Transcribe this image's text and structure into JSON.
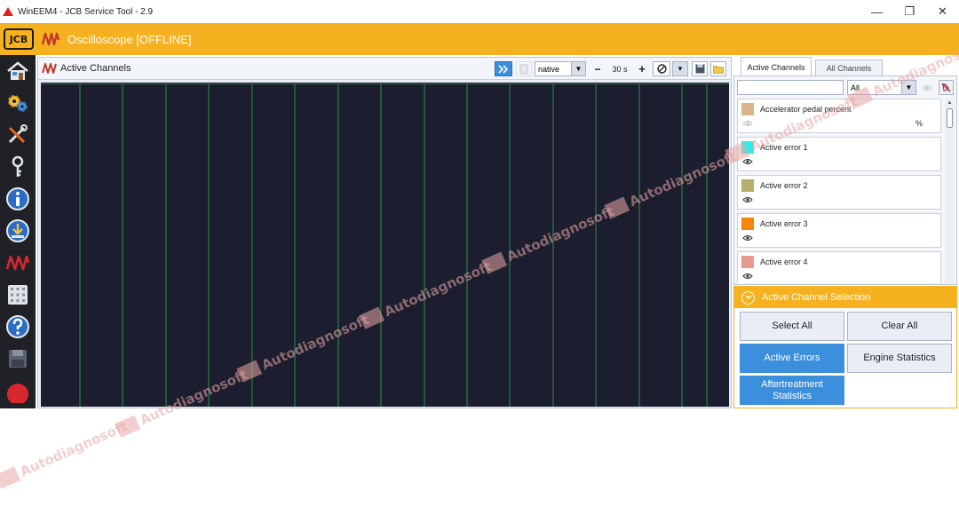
{
  "window": {
    "title": "WinEEM4 - JCB Service Tool - 2.9",
    "minimize_glyph": "—",
    "maximize_glyph": "❐",
    "close_glyph": "✕"
  },
  "header": {
    "logo_text": "JCB",
    "page_title": "Oscilloscope [OFFLINE]"
  },
  "sidebar": {
    "items": [
      {
        "icon": "home-icon"
      },
      {
        "icon": "gears-icon"
      },
      {
        "icon": "tools-icon"
      },
      {
        "icon": "key-icon"
      },
      {
        "icon": "info-icon"
      },
      {
        "icon": "download-icon"
      },
      {
        "icon": "oscilloscope-icon"
      },
      {
        "icon": "keypad-icon"
      },
      {
        "icon": "help-icon"
      },
      {
        "icon": "save-icon"
      },
      {
        "icon": "power-icon"
      }
    ]
  },
  "main": {
    "panel_title": "Active Channels",
    "mode_select": "native",
    "time_window": "30 s",
    "minus_label": "−",
    "plus_label": "+"
  },
  "right": {
    "tabs": [
      {
        "label": "Active Channels",
        "active": true
      },
      {
        "label": "All Channels",
        "active": false
      }
    ],
    "filter": {
      "search_value": "",
      "category": "All"
    },
    "channels": [
      {
        "name": "Accelerator pedal percent",
        "color": "#dcb48a",
        "unit": "%"
      },
      {
        "name": "Active error 1",
        "color": "#22f2f2",
        "unit": ""
      },
      {
        "name": "Active error 2",
        "color": "#b7ad6e",
        "unit": ""
      },
      {
        "name": "Active error 3",
        "color": "#f5860c",
        "unit": ""
      },
      {
        "name": "Active error 4",
        "color": "#e59a8d",
        "unit": ""
      }
    ],
    "selection": {
      "title": "Active Channel Selection",
      "buttons": {
        "select_all": "Select All",
        "clear_all": "Clear All",
        "active_errors": "Active Errors",
        "engine_statistics": "Engine Statistics",
        "aftertreatment_line1": "Aftertreatment",
        "aftertreatment_line2": "Statistics"
      }
    }
  },
  "watermark": "Autodiagnosoft",
  "colors": {
    "accent": "#f5b120",
    "plot_background": "#1c1d2e",
    "grid_line": "#2fa84f",
    "button_blue": "#3b8fdc"
  }
}
